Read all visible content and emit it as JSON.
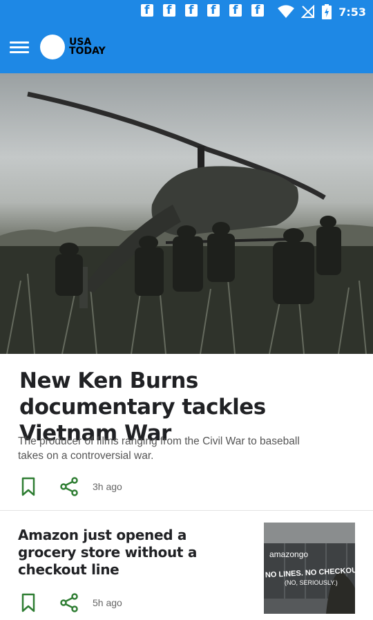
{
  "status_bar": {
    "time": "7:53",
    "notification_icons": [
      "facebook-icon",
      "facebook-icon",
      "facebook-icon",
      "facebook-icon",
      "facebook-icon",
      "facebook-icon"
    ]
  },
  "toolbar": {
    "logo_line1": "USA",
    "logo_line2": "TODAY"
  },
  "articles": [
    {
      "headline": "New Ken Burns documentary tackles Vietnam War",
      "summary_line1": "The producer of films ranging from the Civil War to baseball",
      "summary_line2": "takes on a controversial war.",
      "time_ago": "3h ago"
    },
    {
      "headline": "Amazon just opened a grocery store without a checkout line",
      "time_ago": "5h ago",
      "thumb_brand": "amazongo",
      "thumb_sign1": "NO LINES. NO CHECKOUT.",
      "thumb_sign2": "(NO, SERIOUSLY.)"
    }
  ],
  "colors": {
    "brand_blue": "#1e88e5",
    "headline": "#202124",
    "action_green": "#2e7d32"
  }
}
